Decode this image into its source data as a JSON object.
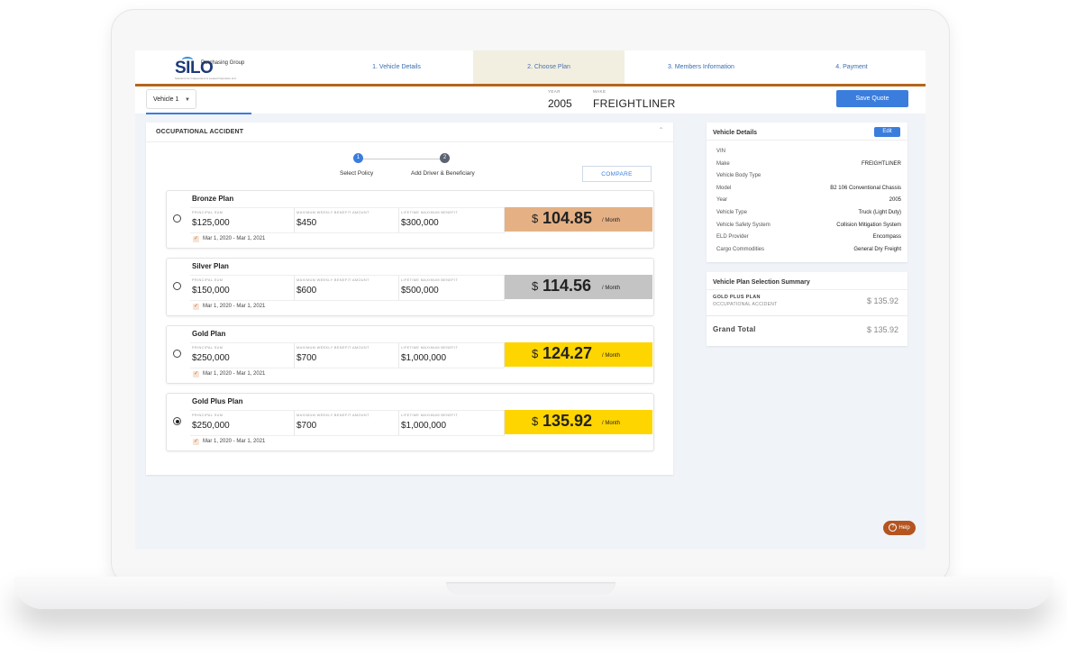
{
  "stepper": {
    "tabs": [
      "1. Vehicle Details",
      "2. Choose Plan",
      "3. Members Information",
      "4. Payment"
    ]
  },
  "logo": {
    "word": "SILO",
    "sub": "Purchasing Group",
    "tagline": "Solutions for Independent & Leased Operators LLC"
  },
  "vehicle_bar": {
    "select_value": "Vehicle 1",
    "year_label": "YEAR",
    "year": "2005",
    "make_label": "MAKE",
    "make": "FREIGHTLINER",
    "save_label": "Save Quote"
  },
  "panel": {
    "title": "OCCUPATIONAL ACCIDENT",
    "wizard": [
      {
        "num": "1",
        "label": "Select Policy"
      },
      {
        "num": "2",
        "label": "Add Driver & Beneficiary"
      }
    ],
    "compare_label": "COMPARE",
    "field_labels": [
      "PRINCIPAL SUM",
      "MAXIMUM WEEKLY BENEFIT AMOUNT",
      "LIFETIME MAXIMUM BENEFIT"
    ],
    "currency": "$",
    "per": "/ Month",
    "plans": [
      {
        "name": "Bronze Plan",
        "principal": "$125,000",
        "weekly": "$450",
        "lifetime": "$300,000",
        "price": "104.85",
        "date": "Mar 1, 2020 - Mar 1, 2021",
        "color": "#e5b184",
        "selected": false
      },
      {
        "name": "Silver Plan",
        "principal": "$150,000",
        "weekly": "$600",
        "lifetime": "$500,000",
        "price": "114.56",
        "date": "Mar 1, 2020 - Mar 1, 2021",
        "color": "#c4c4c4",
        "selected": false
      },
      {
        "name": "Gold Plan",
        "principal": "$250,000",
        "weekly": "$700",
        "lifetime": "$1,000,000",
        "price": "124.27",
        "date": "Mar 1, 2020 - Mar 1, 2021",
        "color": "#ffd500",
        "selected": false
      },
      {
        "name": "Gold Plus Plan",
        "principal": "$250,000",
        "weekly": "$700",
        "lifetime": "$1,000,000",
        "price": "135.92",
        "date": "Mar 1, 2020 - Mar 1, 2021",
        "color": "#ffd500",
        "selected": true
      }
    ]
  },
  "vehicle_details": {
    "title": "Vehicle Details",
    "edit_label": "Edit",
    "rows": [
      {
        "key": "VIN",
        "value": ""
      },
      {
        "key": "Make",
        "value": "FREIGHTLINER"
      },
      {
        "key": "Vehicle Body Type",
        "value": ""
      },
      {
        "key": "Model",
        "value": "B2 106 Conventional Chassis"
      },
      {
        "key": "Year",
        "value": "2005"
      },
      {
        "key": "Vehicle Type",
        "value": "Truck (Light Duty)"
      },
      {
        "key": "Vehicle Safety System",
        "value": "Collision Mitigation System"
      },
      {
        "key": "ELD Provider",
        "value": "Encompass"
      },
      {
        "key": "Cargo Commodities",
        "value": "General Dry Freight"
      }
    ]
  },
  "summary": {
    "title": "Vehicle Plan Selection Summary",
    "plan_name": "GOLD PLUS PLAN",
    "plan_sub": "OCCUPATIONAL ACCIDENT",
    "plan_amount": "$ 135.92",
    "grand_label": "Grand Total",
    "grand_amount": "$ 135.92"
  },
  "help_label": "Help",
  "colors": {
    "accent": "#3b7ddd",
    "brand_bar": "#b5651d",
    "help": "#b5541f"
  }
}
